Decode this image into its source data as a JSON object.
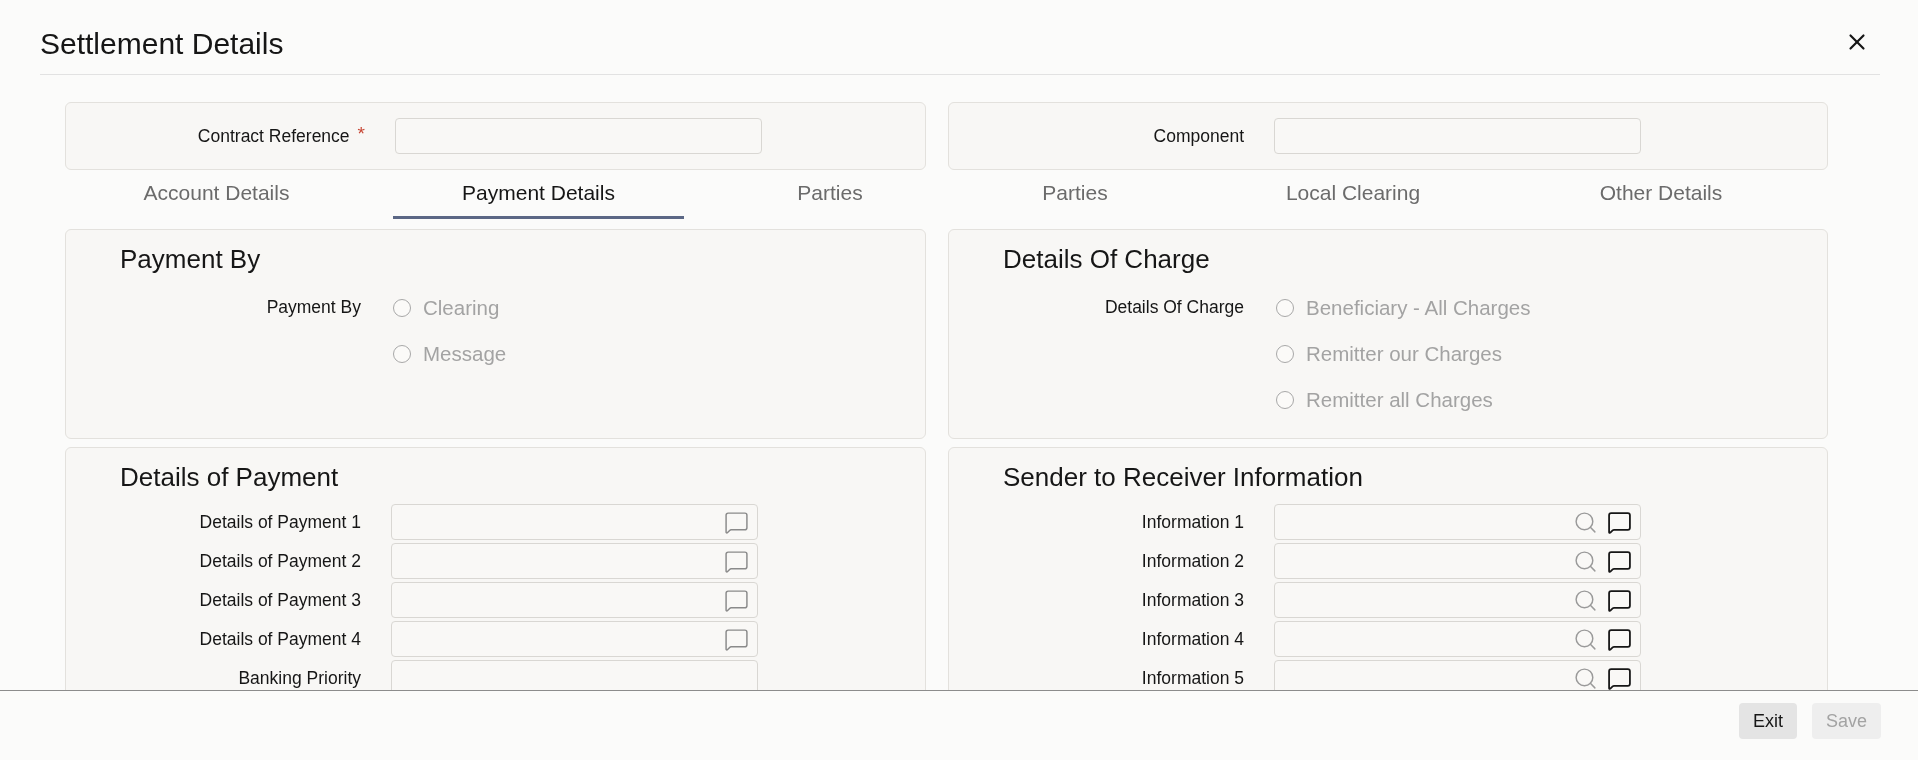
{
  "dialog": {
    "title": "Settlement Details"
  },
  "header_fields": [
    {
      "label": "Contract Reference",
      "required_marker": "*"
    },
    {
      "label": "Component"
    }
  ],
  "tabs": [
    {
      "label": "Account Details",
      "selected": false
    },
    {
      "label": "Payment Details",
      "selected": true
    },
    {
      "label": "Parties",
      "selected": false
    },
    {
      "label": "Parties",
      "selected": false
    },
    {
      "label": "Local Clearing",
      "selected": false
    },
    {
      "label": "Other Details",
      "selected": false
    }
  ],
  "sections": [
    {
      "kind": "radio",
      "heading": "Payment By",
      "label": "Payment By",
      "options": [
        {
          "label": "Clearing",
          "selected": false,
          "disabled": true
        },
        {
          "label": "Message",
          "selected": false,
          "disabled": true
        }
      ]
    },
    {
      "kind": "radio",
      "heading": "Details Of Charge",
      "label": "Details Of Charge",
      "options": [
        {
          "label": "Beneficiary - All Charges",
          "selected": false,
          "disabled": true
        },
        {
          "label": "Remitter our Charges",
          "selected": false,
          "disabled": true
        },
        {
          "label": "Remitter all Charges",
          "selected": false,
          "disabled": true
        }
      ]
    },
    {
      "kind": "fields",
      "heading": "Details of Payment",
      "fields": [
        {
          "label": "Details of Payment 1",
          "kind": "note"
        },
        {
          "label": "Details of Payment 2",
          "kind": "note"
        },
        {
          "label": "Details of Payment 3",
          "kind": "note"
        },
        {
          "label": "Details of Payment 4",
          "kind": "note"
        },
        {
          "label": "Banking Priority",
          "kind": "plain"
        }
      ]
    },
    {
      "kind": "fields",
      "heading": "Sender to Receiver Information",
      "fields": [
        {
          "label": "Information 1",
          "kind": "lookup"
        },
        {
          "label": "Information 2",
          "kind": "lookup"
        },
        {
          "label": "Information 3",
          "kind": "lookup"
        },
        {
          "label": "Information 4",
          "kind": "lookup"
        },
        {
          "label": "Information 5",
          "kind": "lookup"
        }
      ]
    }
  ],
  "footer": {
    "buttons": [
      {
        "label": "Exit",
        "disabled": false
      },
      {
        "label": "Save",
        "disabled": true
      }
    ]
  }
}
